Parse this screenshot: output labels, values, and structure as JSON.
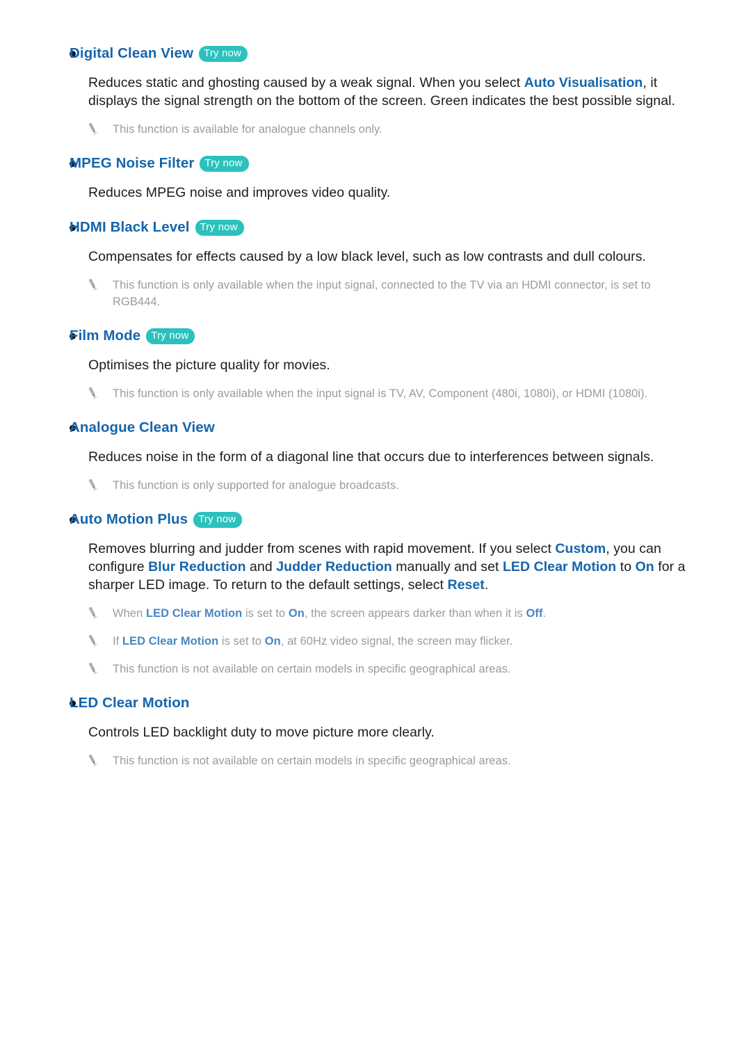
{
  "document": {
    "type": "tv-e-manual-page",
    "background_color": "#ffffff",
    "heading_color": "#1565ab",
    "badge_color": "#2cc1bd",
    "body_color": "#1c1c1c",
    "note_color": "#9b9b9b",
    "badge_label": "Try now",
    "note_icon": "pencil-icon",
    "bullet_glyph": "•"
  },
  "sections": [
    {
      "id": "digital-clean-view",
      "title": "Digital Clean View",
      "badge": "Try now",
      "body": {
        "parts": [
          {
            "t": "Reduces static and ghosting caused by a weak signal. When you select ",
            "kw": false
          },
          {
            "t": "Auto Visualisation",
            "kw": true
          },
          {
            "t": ", it displays the signal strength on the bottom of the screen. Green indicates the best possible signal.",
            "kw": false
          }
        ]
      },
      "notes": [
        {
          "parts": [
            {
              "t": "This function is available for analogue channels only.",
              "kw": false
            }
          ]
        }
      ]
    },
    {
      "id": "mpeg-noise-filter",
      "title": "MPEG Noise Filter",
      "badge": "Try now",
      "body": {
        "parts": [
          {
            "t": "Reduces MPEG noise and improves video quality.",
            "kw": false
          }
        ]
      },
      "notes": []
    },
    {
      "id": "hdmi-black-level",
      "title": "HDMI Black Level",
      "badge": "Try now",
      "body": {
        "parts": [
          {
            "t": "Compensates for effects caused by a low black level, such as low contrasts and dull colours.",
            "kw": false
          }
        ]
      },
      "notes": [
        {
          "parts": [
            {
              "t": "This function is only available when the input signal, connected to the TV via an HDMI connector, is set to RGB444.",
              "kw": false
            }
          ]
        }
      ]
    },
    {
      "id": "film-mode",
      "title": "Film Mode",
      "badge": "Try now",
      "body": {
        "parts": [
          {
            "t": "Optimises the picture quality for movies.",
            "kw": false
          }
        ]
      },
      "notes": [
        {
          "parts": [
            {
              "t": "This function is only available when the input signal is TV, AV, Component (480i, 1080i), or HDMI (1080i).",
              "kw": false
            }
          ]
        }
      ]
    },
    {
      "id": "analogue-clean-view",
      "title": "Analogue Clean View",
      "badge": null,
      "body": {
        "parts": [
          {
            "t": "Reduces noise in the form of a diagonal line that occurs due to interferences between signals.",
            "kw": false
          }
        ]
      },
      "notes": [
        {
          "parts": [
            {
              "t": "This function is only supported for analogue broadcasts.",
              "kw": false
            }
          ]
        }
      ]
    },
    {
      "id": "auto-motion-plus",
      "title": "Auto Motion Plus",
      "badge": "Try now",
      "body": {
        "parts": [
          {
            "t": "Removes blurring and judder from scenes with rapid movement. If you select ",
            "kw": false
          },
          {
            "t": "Custom",
            "kw": true
          },
          {
            "t": ", you can configure ",
            "kw": false
          },
          {
            "t": "Blur Reduction",
            "kw": true
          },
          {
            "t": " and ",
            "kw": false
          },
          {
            "t": "Judder Reduction",
            "kw": true
          },
          {
            "t": " manually and set ",
            "kw": false
          },
          {
            "t": "LED Clear Motion",
            "kw": true
          },
          {
            "t": " to ",
            "kw": false
          },
          {
            "t": "On",
            "kw": true
          },
          {
            "t": " for a sharper LED image. To return to the default settings, select ",
            "kw": false
          },
          {
            "t": "Reset",
            "kw": true
          },
          {
            "t": ".",
            "kw": false
          }
        ]
      },
      "notes": [
        {
          "parts": [
            {
              "t": "When ",
              "kw": false
            },
            {
              "t": "LED Clear Motion",
              "kw": true
            },
            {
              "t": " is set to ",
              "kw": false
            },
            {
              "t": "On",
              "kw": true
            },
            {
              "t": ", the screen appears darker than when it is ",
              "kw": false
            },
            {
              "t": "Off",
              "kw": true
            },
            {
              "t": ".",
              "kw": false
            }
          ]
        },
        {
          "parts": [
            {
              "t": "If ",
              "kw": false
            },
            {
              "t": "LED Clear Motion",
              "kw": true
            },
            {
              "t": " is set to ",
              "kw": false
            },
            {
              "t": "On",
              "kw": true
            },
            {
              "t": ", at 60Hz video signal, the screen may flicker.",
              "kw": false
            }
          ]
        },
        {
          "parts": [
            {
              "t": "This function is not available on certain models in specific geographical areas.",
              "kw": false
            }
          ]
        }
      ]
    },
    {
      "id": "led-clear-motion",
      "title": "LED Clear Motion",
      "badge": null,
      "body": {
        "parts": [
          {
            "t": "Controls LED backlight duty to move picture more clearly.",
            "kw": false
          }
        ]
      },
      "notes": [
        {
          "parts": [
            {
              "t": "This function is not available on certain models in specific geographical areas.",
              "kw": false
            }
          ]
        }
      ]
    }
  ]
}
